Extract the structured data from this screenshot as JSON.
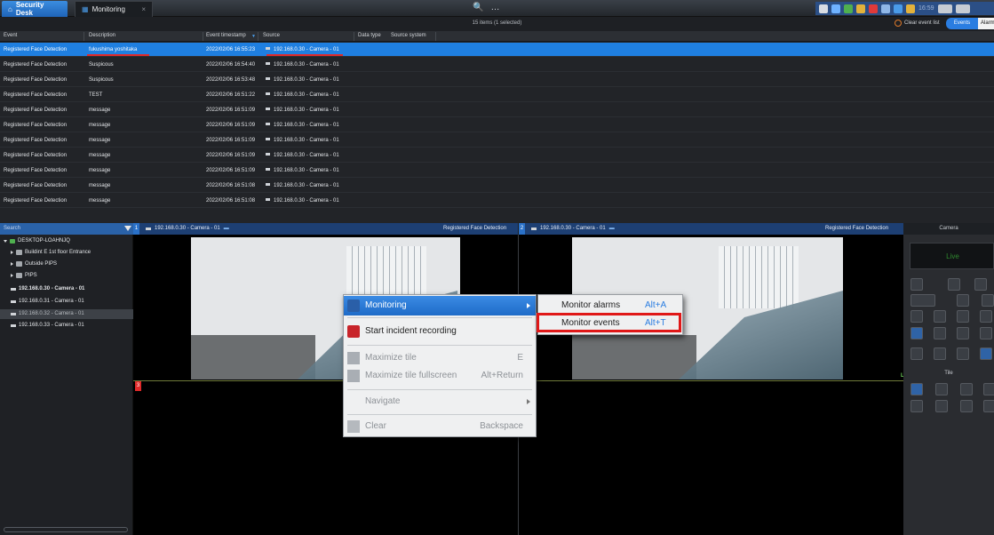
{
  "tabs": {
    "security_desk": "Security Desk",
    "monitoring": "Monitoring",
    "close_glyph": "×"
  },
  "topbar": {
    "search_glyph": "🔍",
    "more_glyph": "…",
    "time": "16:59"
  },
  "events": {
    "items_count": "15 items (1 selected)",
    "clear_list": "Clear event list",
    "view_events": "Events",
    "view_alarms": "Alarm",
    "columns": {
      "event": "Event",
      "description": "Description",
      "timestamp": "Event timestamp",
      "source": "Source",
      "data_type": "Data type",
      "source_system": "Source system"
    },
    "rows": [
      {
        "event": "Registered Face Detection",
        "description": "fukushima yoshitaka",
        "timestamp": "2022/02/06 16:55:23",
        "source": "192.168.0.30 - Camera - 01"
      },
      {
        "event": "Registered Face Detection",
        "description": "Suspicous",
        "timestamp": "2022/02/06 16:54:40",
        "source": "192.168.0.30 - Camera - 01"
      },
      {
        "event": "Registered Face Detection",
        "description": "Suspicous",
        "timestamp": "2022/02/06 16:53:48",
        "source": "192.168.0.30 - Camera - 01"
      },
      {
        "event": "Registered Face Detection",
        "description": "TEST",
        "timestamp": "2022/02/06 16:51:22",
        "source": "192.168.0.30 - Camera - 01"
      },
      {
        "event": "Registered Face Detection",
        "description": "message",
        "timestamp": "2022/02/06 16:51:09",
        "source": "192.168.0.30 - Camera - 01"
      },
      {
        "event": "Registered Face Detection",
        "description": "message",
        "timestamp": "2022/02/06 16:51:09",
        "source": "192.168.0.30 - Camera - 01"
      },
      {
        "event": "Registered Face Detection",
        "description": "message",
        "timestamp": "2022/02/06 16:51:09",
        "source": "192.168.0.30 - Camera - 01"
      },
      {
        "event": "Registered Face Detection",
        "description": "message",
        "timestamp": "2022/02/06 16:51:09",
        "source": "192.168.0.30 - Camera - 01"
      },
      {
        "event": "Registered Face Detection",
        "description": "message",
        "timestamp": "2022/02/06 16:51:09",
        "source": "192.168.0.30 - Camera - 01"
      },
      {
        "event": "Registered Face Detection",
        "description": "message",
        "timestamp": "2022/02/06 16:51:08",
        "source": "192.168.0.30 - Camera - 01"
      },
      {
        "event": "Registered Face Detection",
        "description": "message",
        "timestamp": "2022/02/06 16:51:08",
        "source": "192.168.0.30 - Camera - 01"
      }
    ]
  },
  "sidebar": {
    "search_placeholder": "Search",
    "tree": [
      {
        "label": "DESKTOP-LOAHNJQ"
      },
      {
        "label": "Buildint E 1st floor Entrance"
      },
      {
        "label": "Outside PIPS"
      },
      {
        "label": "PIPS"
      },
      {
        "label": "192.168.0.30 - Camera - 01"
      },
      {
        "label": "192.168.0.31 - Camera - 01"
      },
      {
        "label": "192.168.0.32 - Camera - 01"
      },
      {
        "label": "192.168.0.33 - Camera - 01"
      }
    ]
  },
  "tiles": [
    {
      "number": "1",
      "camera": "192.168.0.30 - Camera - 01",
      "event": "Registered Face Detection"
    },
    {
      "number": "2",
      "camera": "192.168.0.30 - Camera - 01",
      "event": "Registered Face Detection",
      "live": "Live"
    },
    {
      "number": "3"
    }
  ],
  "camera_panel": {
    "title": "Camera",
    "live": "Live",
    "tile_title": "Tile"
  },
  "context_menu": {
    "items": [
      {
        "label": "Monitoring",
        "shortcut": ""
      },
      {
        "label": "Start incident recording",
        "shortcut": ""
      },
      {
        "label": "Maximize tile",
        "shortcut": "E"
      },
      {
        "label": "Maximize tile fullscreen",
        "shortcut": "Alt+Return"
      },
      {
        "label": "Navigate",
        "shortcut": ""
      },
      {
        "label": "Clear",
        "shortcut": "Backspace"
      }
    ],
    "submenu": [
      {
        "label": "Monitor alarms",
        "shortcut": "Alt+A"
      },
      {
        "label": "Monitor events",
        "shortcut": "Alt+T"
      }
    ]
  },
  "colors": {
    "accent": "#1f7fe0",
    "highlight_box": "#e01818"
  }
}
